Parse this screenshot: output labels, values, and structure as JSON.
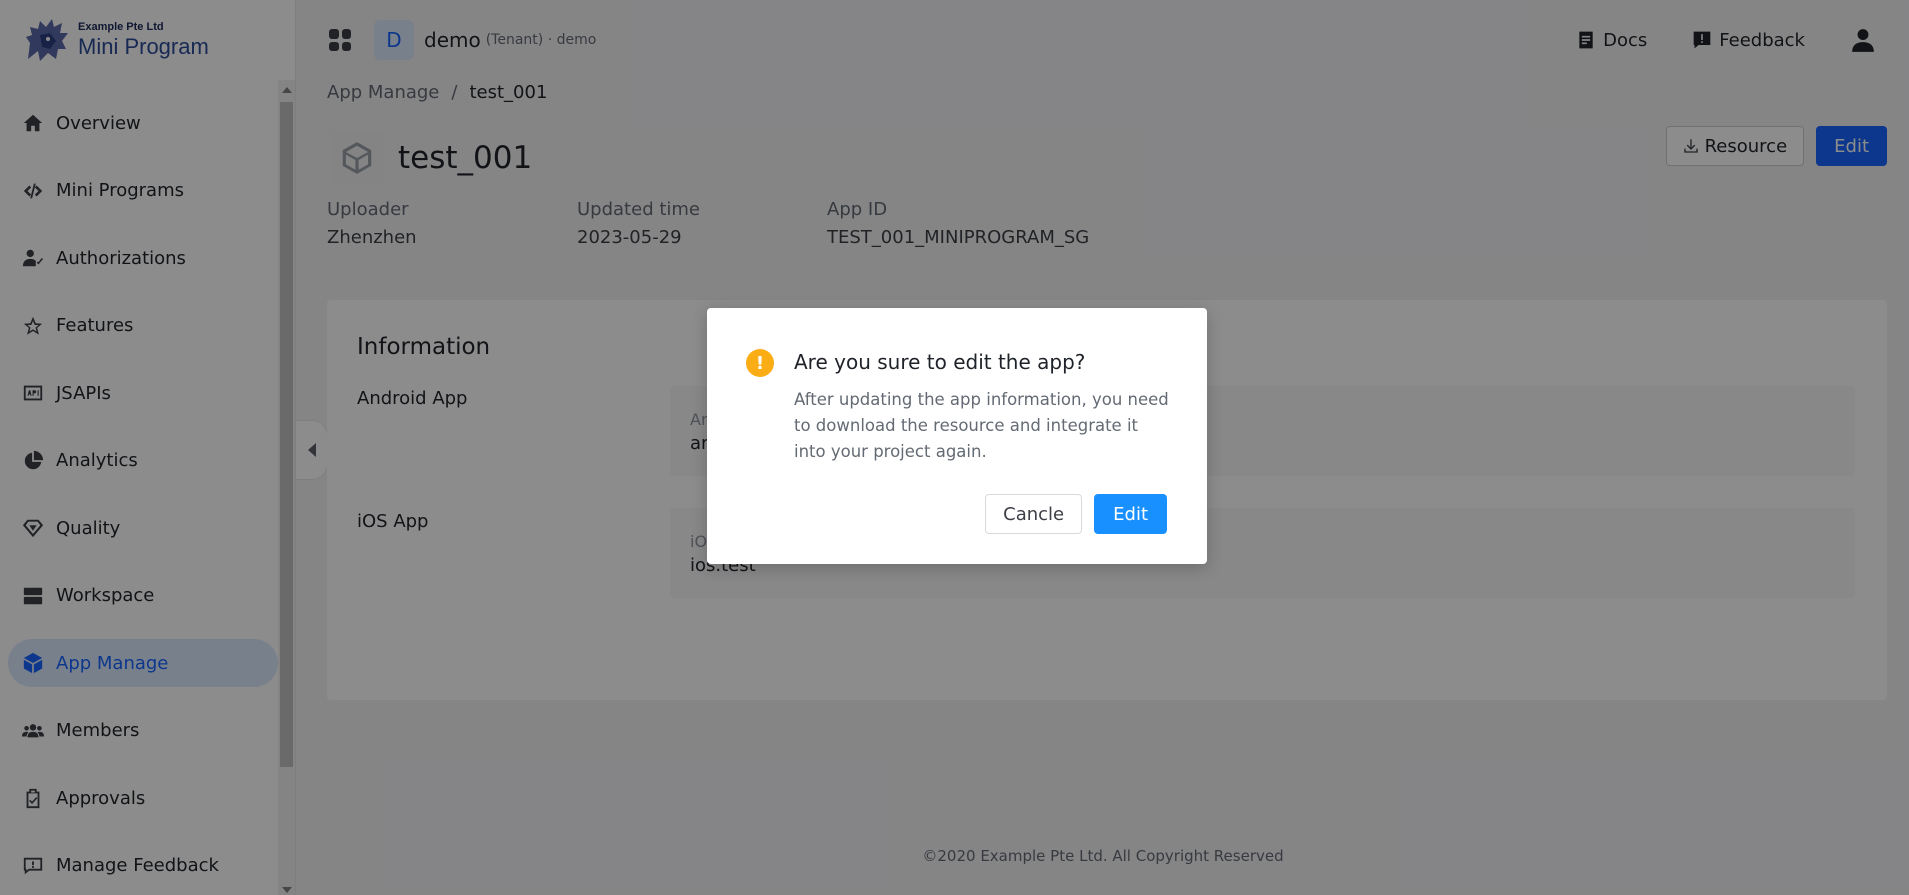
{
  "brand": {
    "company": "Example Pte Ltd",
    "product": "Mini Program"
  },
  "sidebar": {
    "items": [
      {
        "label": "Overview",
        "icon": "home-icon"
      },
      {
        "label": "Mini Programs",
        "icon": "code-icon"
      },
      {
        "label": "Authorizations",
        "icon": "user-check-icon"
      },
      {
        "label": "Features",
        "icon": "star-icon"
      },
      {
        "label": "JSAPIs",
        "icon": "api-icon"
      },
      {
        "label": "Analytics",
        "icon": "pie-chart-icon"
      },
      {
        "label": "Quality",
        "icon": "diamond-icon"
      },
      {
        "label": "Workspace",
        "icon": "server-icon"
      },
      {
        "label": "App Manage",
        "icon": "cube-icon",
        "active": true
      },
      {
        "label": "Members",
        "icon": "team-icon"
      },
      {
        "label": "Approvals",
        "icon": "clipboard-check-icon"
      },
      {
        "label": "Manage Feedback",
        "icon": "message-icon"
      }
    ]
  },
  "header": {
    "tenant_initial": "D",
    "tenant_name": "demo",
    "tenant_meta": "(Tenant) · demo",
    "docs_label": "Docs",
    "feedback_label": "Feedback"
  },
  "breadcrumb": {
    "parent": "App Manage",
    "separator": "/",
    "current": "test_001"
  },
  "app": {
    "name": "test_001",
    "resource_label": "Resource",
    "edit_label": "Edit",
    "meta": [
      {
        "label": "Uploader",
        "value": "Zhenzhen"
      },
      {
        "label": "Updated time",
        "value": "2023-05-29"
      },
      {
        "label": "App ID",
        "value": "TEST_001_MINIPROGRAM_SG"
      }
    ]
  },
  "information": {
    "title": "Information",
    "android": {
      "label": "Android App",
      "key_partial": "Ar",
      "value_partial": "ar"
    },
    "ios": {
      "label": "iOS App",
      "key_partial": "iO",
      "value": "ios.test"
    }
  },
  "footer": {
    "text": "©2020 Example Pte Ltd. All Copyright Reserved"
  },
  "modal": {
    "icon": "!",
    "title": "Are you sure to edit the app?",
    "body": "After updating the app information, you need to download the resource and integrate it into your project again.",
    "cancel_label": "Cancle",
    "ok_label": "Edit"
  },
  "colors": {
    "accent": "#1664ff",
    "modal_ok": "#1890ff",
    "warning": "#faad14"
  }
}
